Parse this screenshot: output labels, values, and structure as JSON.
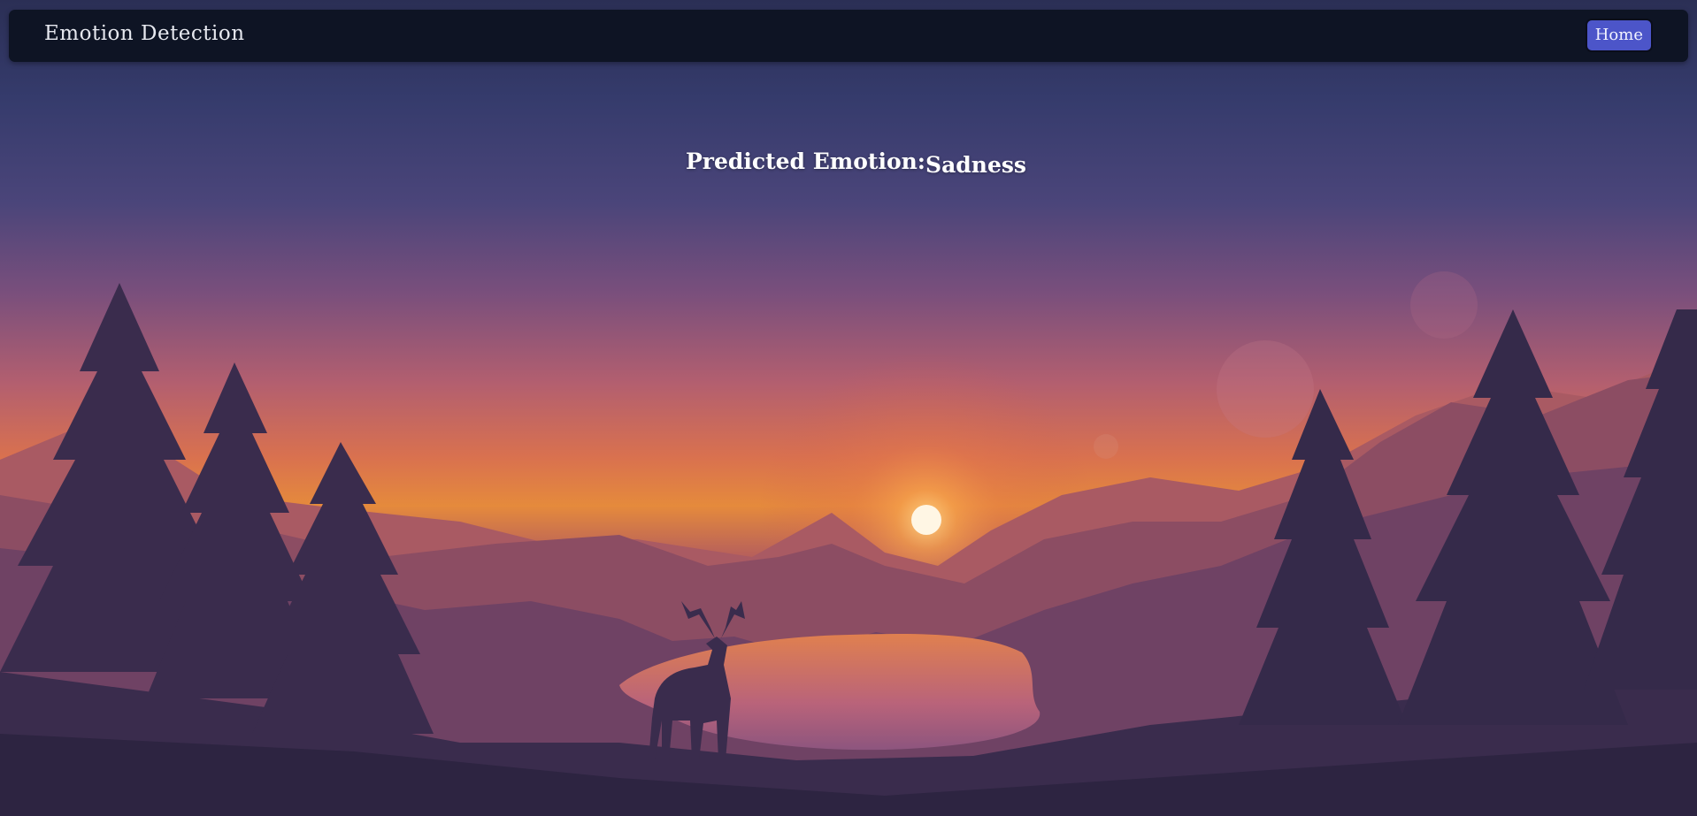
{
  "navbar": {
    "brand": "Emotion Detection",
    "home_label": "Home"
  },
  "result": {
    "label": "Predicted Emotion:",
    "value": "Sadness"
  },
  "background": {
    "description_icon": "sunset-landscape-illustration"
  },
  "colors": {
    "navbar_bg": "#0e1424",
    "button_bg": "#4c55c9",
    "text": "#ffffff"
  }
}
